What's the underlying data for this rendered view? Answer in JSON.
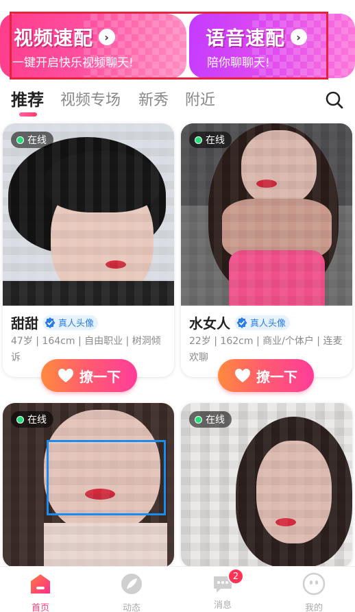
{
  "banners": {
    "video": {
      "title": "视频速配",
      "subtitle": "一键开启快乐视频聊天!"
    },
    "voice": {
      "title": "语音速配",
      "subtitle": "陪你聊聊天!"
    },
    "arrow": "›"
  },
  "tabs": [
    "推荐",
    "视频专场",
    "新秀",
    "附近"
  ],
  "cards": [
    {
      "online": "在线",
      "name": "甜甜",
      "verified": "真人头像",
      "info": "47岁 | 164cm | 自由职业 | 树洞倾诉",
      "action": "撩一下"
    },
    {
      "online": "在线",
      "name": "水女人",
      "verified": "真人头像",
      "info": "22岁 | 162cm | 商业/个体户 | 连麦欢聊",
      "action": "撩一下"
    },
    {
      "online": "在线"
    },
    {
      "online": "在线"
    }
  ],
  "nav": {
    "items": [
      {
        "label": "首页",
        "icon": "home-icon"
      },
      {
        "label": "动态",
        "icon": "feed-icon"
      },
      {
        "label": "消息",
        "icon": "message-icon"
      },
      {
        "label": "我的",
        "icon": "profile-icon"
      }
    ],
    "message_badge": "2"
  },
  "colors": {
    "accent_pink": "#ff3d7a",
    "video_banner": "#ff3d8b",
    "voice_banner": "#c43bff",
    "verified_blue": "#2a7de1",
    "online_green": "#24e07a"
  }
}
